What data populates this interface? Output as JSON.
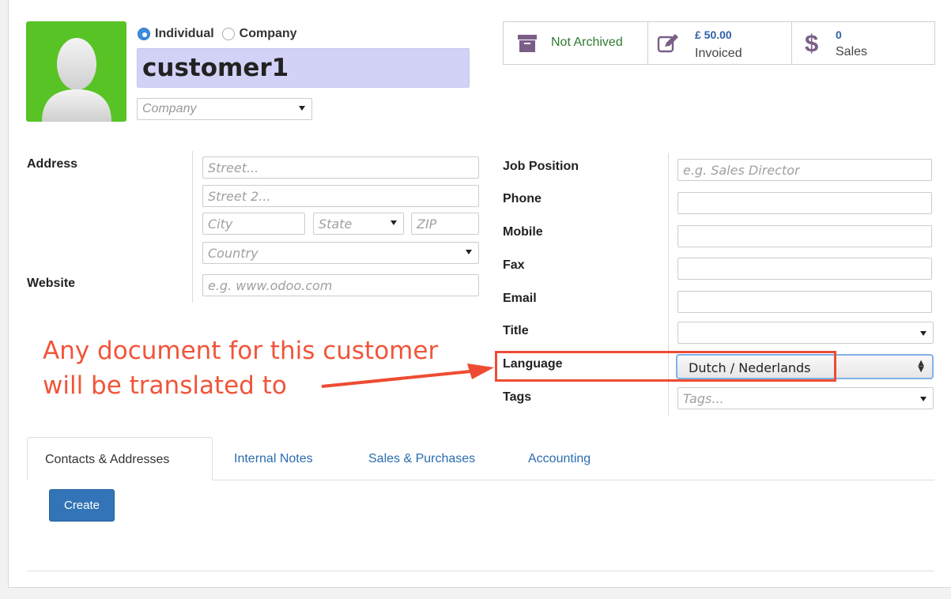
{
  "header": {
    "partner_type": {
      "individual": "Individual",
      "company": "Company",
      "selected": "Individual"
    },
    "name": "customer1",
    "company_placeholder": "Company"
  },
  "stats": {
    "archive": "Not Archived",
    "invoiced_amount": "£ 50.00",
    "invoiced_label": "Invoiced",
    "sales_count": "0",
    "sales_label": "Sales"
  },
  "address": {
    "label": "Address",
    "street_placeholder": "Street...",
    "street2_placeholder": "Street 2...",
    "city_placeholder": "City",
    "state_placeholder": "State",
    "zip_placeholder": "ZIP",
    "country_placeholder": "Country"
  },
  "website": {
    "label": "Website",
    "placeholder": "e.g. www.odoo.com"
  },
  "right_fields": {
    "job_position": {
      "label": "Job Position",
      "placeholder": "e.g. Sales Director"
    },
    "phone": {
      "label": "Phone"
    },
    "mobile": {
      "label": "Mobile"
    },
    "fax": {
      "label": "Fax"
    },
    "email": {
      "label": "Email"
    },
    "title": {
      "label": "Title"
    },
    "language": {
      "label": "Language",
      "value": "Dutch / Nederlands"
    },
    "tags": {
      "label": "Tags",
      "placeholder": "Tags..."
    }
  },
  "annotation": {
    "line1": "Any document for this customer",
    "line2": "will be translated to",
    "color": "#f0553a"
  },
  "tabs": [
    {
      "label": "Contacts & Addresses",
      "active": true
    },
    {
      "label": "Internal Notes"
    },
    {
      "label": "Sales & Purchases"
    },
    {
      "label": "Accounting"
    }
  ],
  "create_button": "Create",
  "colors": {
    "avatar": "#58c324",
    "primary": "#3274b7",
    "name_field": "#d2d2f7"
  }
}
